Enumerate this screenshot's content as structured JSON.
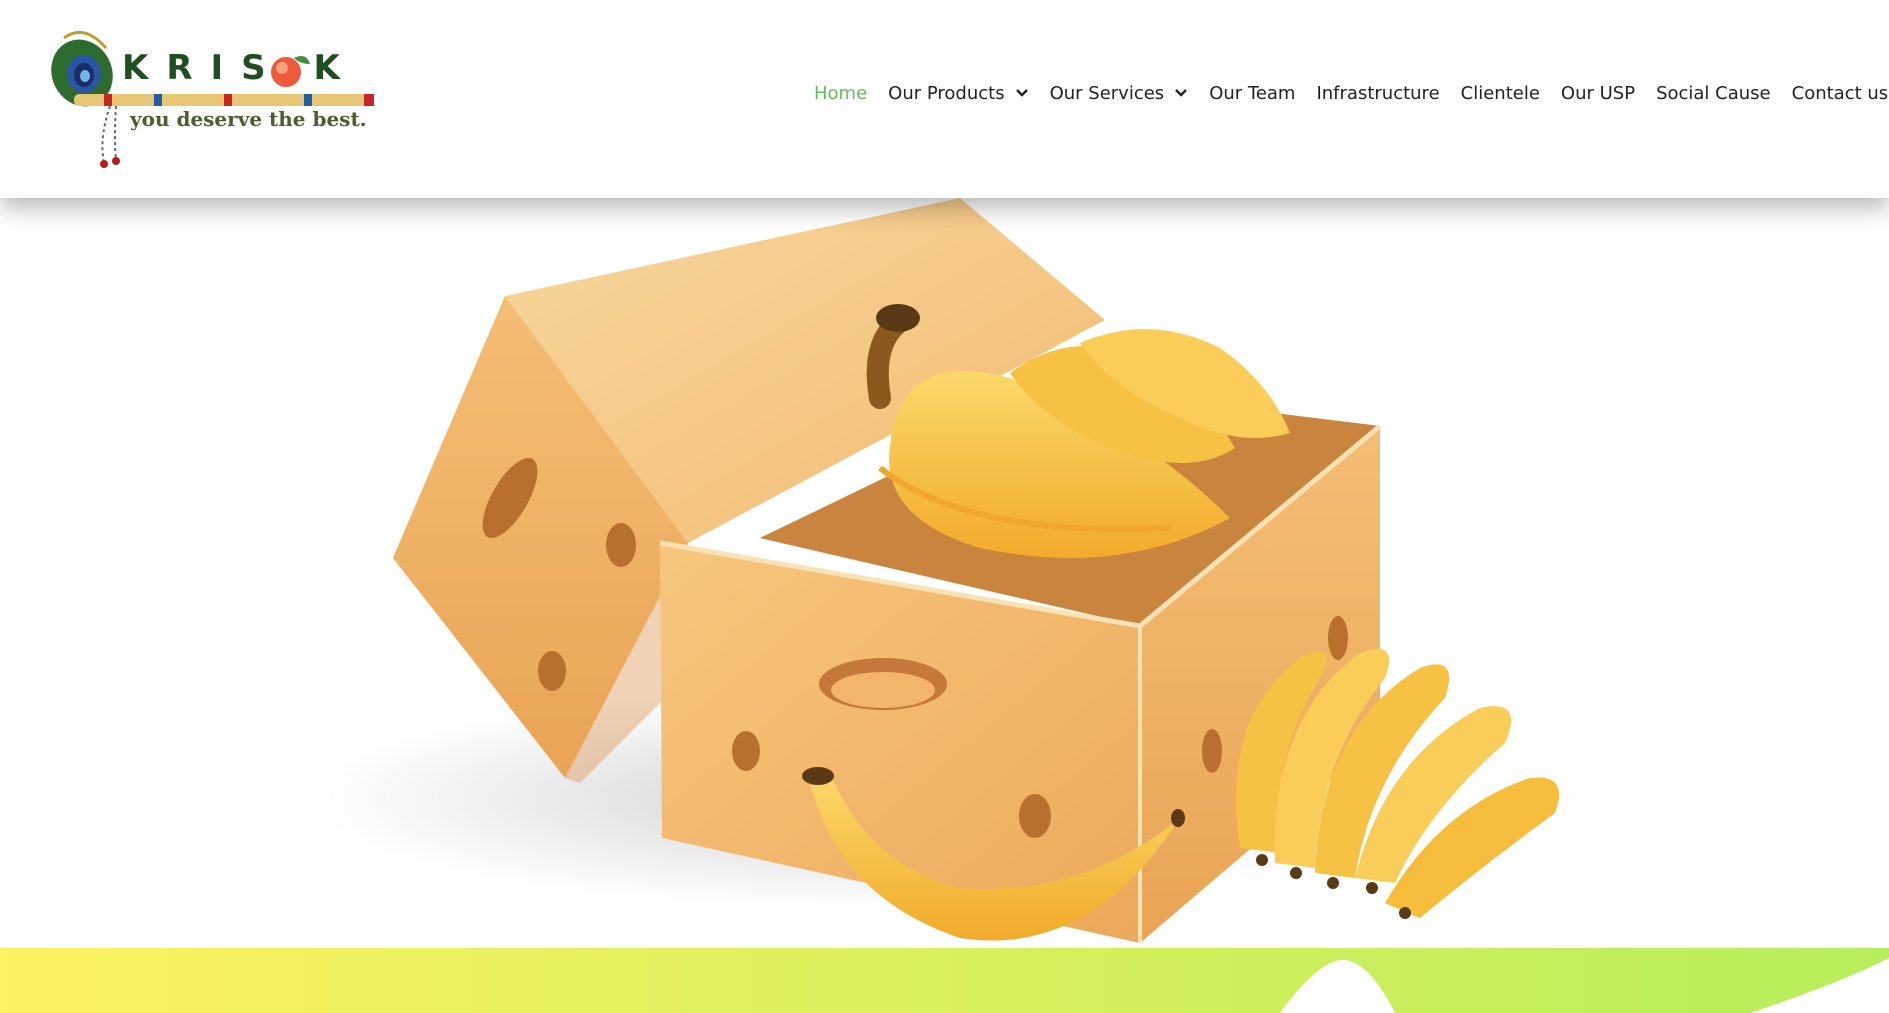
{
  "brand": {
    "logo_text": "KRIS  K",
    "tagline": "you deserve the best."
  },
  "nav": {
    "items": [
      {
        "label": "Home",
        "active": true,
        "dropdown": false
      },
      {
        "label": "Our Products",
        "active": false,
        "dropdown": true
      },
      {
        "label": "Our Services",
        "active": false,
        "dropdown": true
      },
      {
        "label": "Our Team",
        "active": false,
        "dropdown": false
      },
      {
        "label": "Infrastructure",
        "active": false,
        "dropdown": false
      },
      {
        "label": "Clientele",
        "active": false,
        "dropdown": false
      },
      {
        "label": "Our USP",
        "active": false,
        "dropdown": false
      },
      {
        "label": "Social Cause",
        "active": false,
        "dropdown": false
      },
      {
        "label": "Contact us",
        "active": false,
        "dropdown": false
      }
    ],
    "active_color": "#63c05a",
    "text_color": "#222222"
  },
  "hero": {
    "image_subject": "banana-box-illustration"
  },
  "colors": {
    "wave_start": "#fdf25f",
    "wave_end": "#b6ee5a",
    "box": "#f2b869",
    "banana": "#f7c548"
  }
}
